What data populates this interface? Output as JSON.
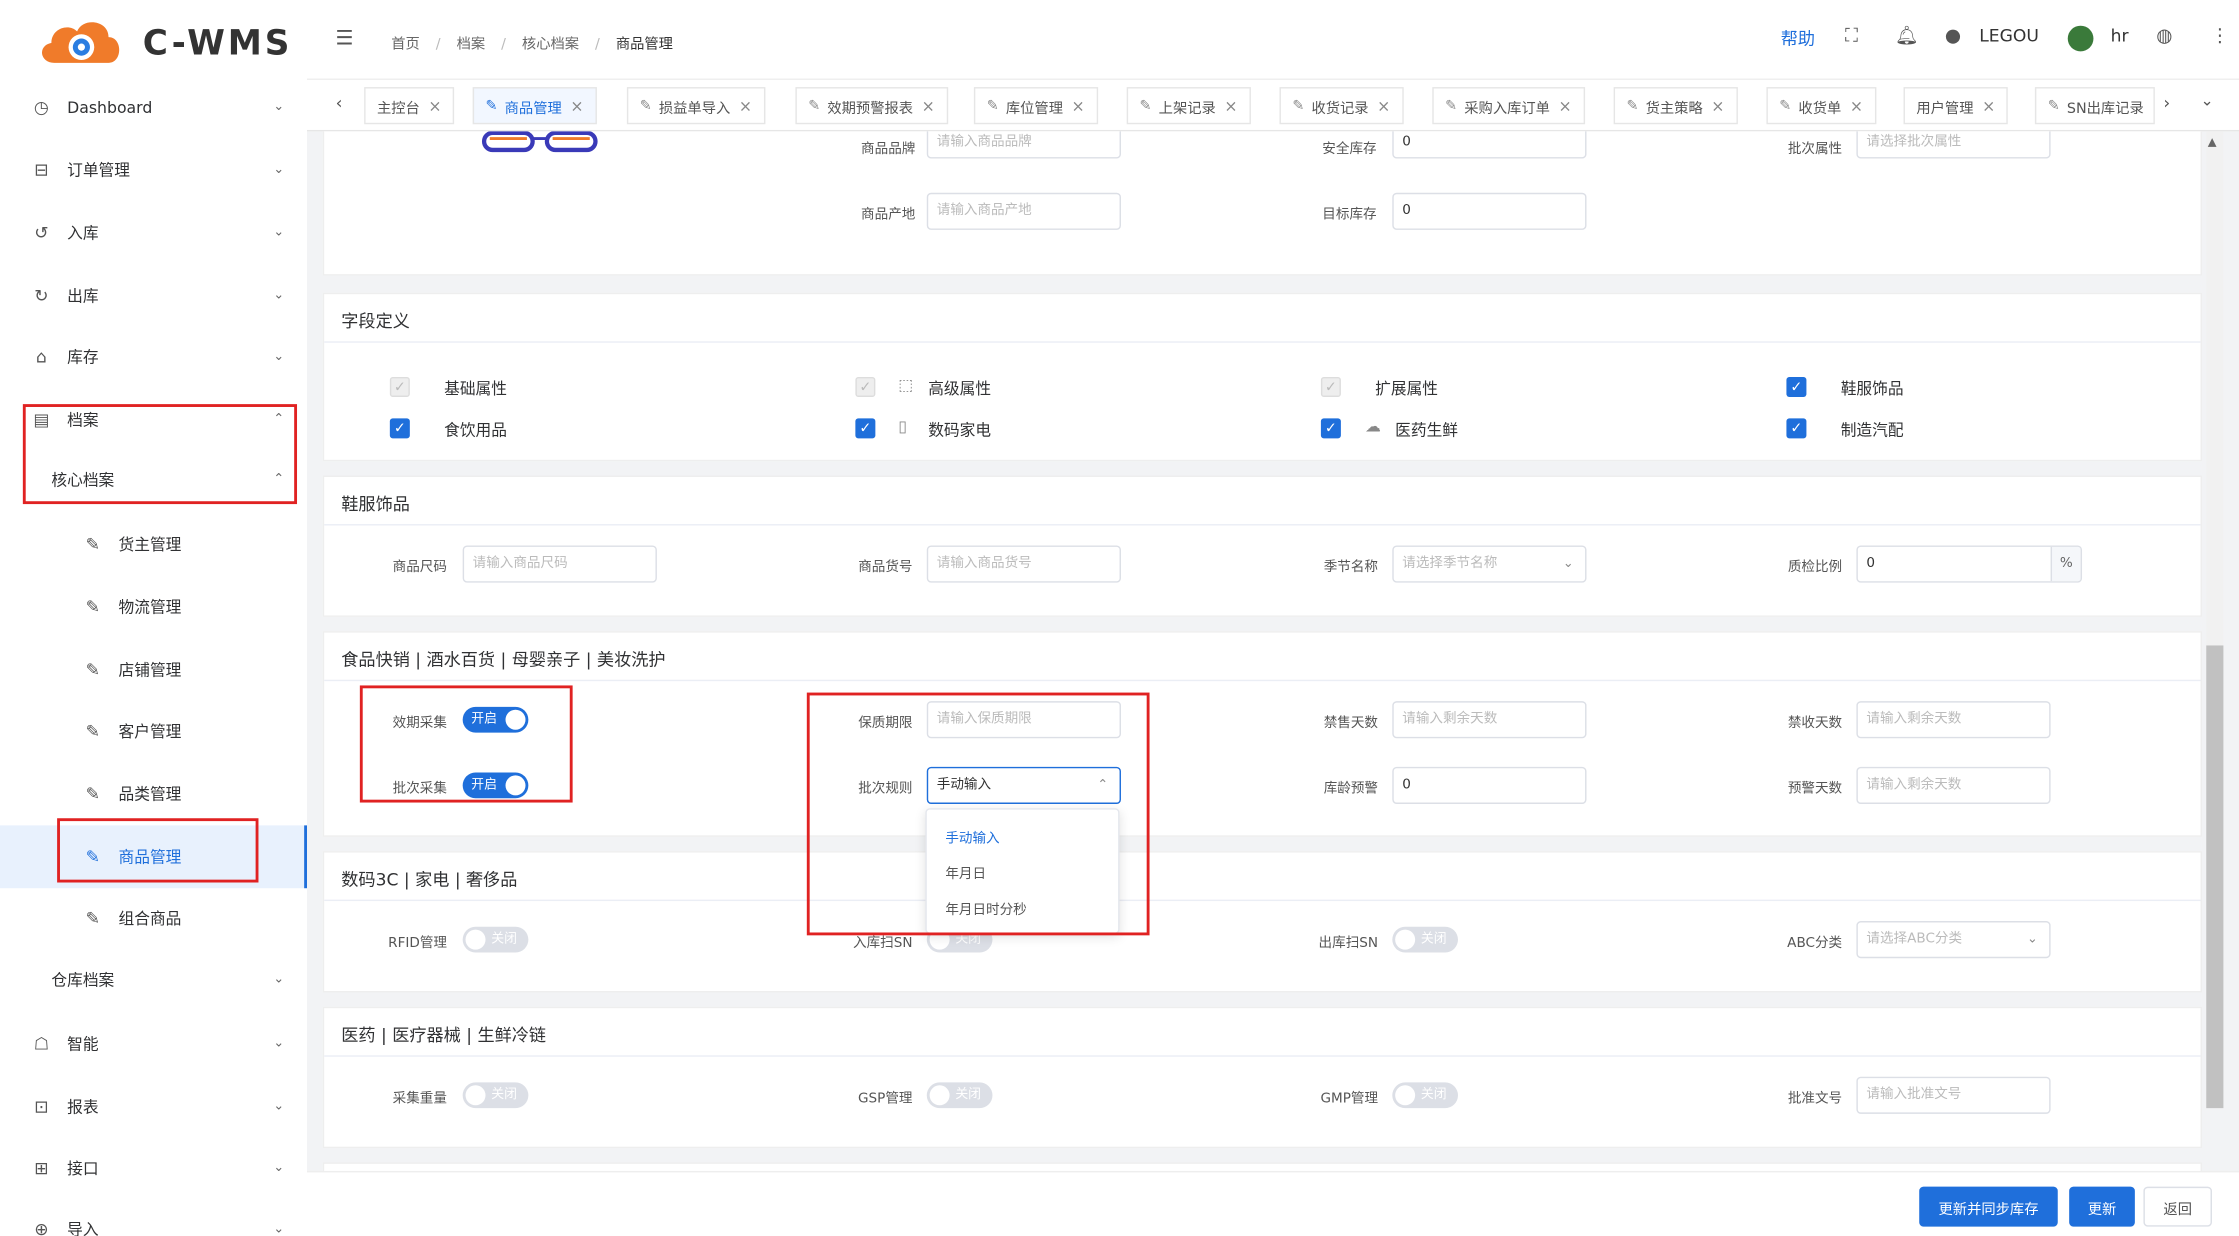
{
  "app": {
    "logo_text": "C-WMS"
  },
  "sidebar": {
    "items": [
      {
        "label": "Dashboard"
      },
      {
        "label": "订单管理"
      },
      {
        "label": "入库"
      },
      {
        "label": "出库"
      },
      {
        "label": "库存"
      },
      {
        "label": "档案"
      },
      {
        "label": "核心档案"
      },
      {
        "label": "货主管理"
      },
      {
        "label": "物流管理"
      },
      {
        "label": "店铺管理"
      },
      {
        "label": "客户管理"
      },
      {
        "label": "品类管理"
      },
      {
        "label": "商品管理"
      },
      {
        "label": "组合商品"
      },
      {
        "label": "仓库档案"
      },
      {
        "label": "智能"
      },
      {
        "label": "报表"
      },
      {
        "label": "接口"
      },
      {
        "label": "导入"
      }
    ]
  },
  "header": {
    "breadcrumb": [
      "首页",
      "档案",
      "核心档案",
      "商品管理"
    ],
    "help": "帮助",
    "company": "LEGOU",
    "user": "hr"
  },
  "tabs": [
    "主控台",
    "商品管理",
    "损益单导入",
    "效期预警报表",
    "库位管理",
    "上架记录",
    "收货记录",
    "采购入库订单",
    "货主策略",
    "收货单",
    "用户管理",
    "SN出库记录"
  ],
  "basic": {
    "brand_label": "商品品牌",
    "brand_ph": "请输入商品品牌",
    "safety_label": "安全库存",
    "safety_val": "0",
    "batch_attr_label": "批次属性",
    "batch_attr_ph": "请选择批次属性",
    "origin_label": "商品产地",
    "origin_ph": "请输入商品产地",
    "target_label": "目标库存",
    "target_val": "0"
  },
  "fields": {
    "title": "字段定义",
    "options": [
      {
        "label": "基础属性"
      },
      {
        "label": "高级属性"
      },
      {
        "label": "扩展属性"
      },
      {
        "label": "鞋服饰品"
      },
      {
        "label": "食饮用品"
      },
      {
        "label": "数码家电"
      },
      {
        "label": "医药生鲜"
      },
      {
        "label": "制造汽配"
      }
    ]
  },
  "apparel": {
    "title": "鞋服饰品",
    "size_label": "商品尺码",
    "size_ph": "请输入商品尺码",
    "sku_label": "商品货号",
    "sku_ph": "请输入商品货号",
    "season_label": "季节名称",
    "season_ph": "请选择季节名称",
    "qc_label": "质检比例",
    "qc_val": "0",
    "qc_unit": "%"
  },
  "food": {
    "title": "食品快销 | 酒水百货 | 母婴亲子 | 美妆洗护",
    "expiry_label": "效期采集",
    "expiry_state": "开启",
    "batch_label": "批次采集",
    "batch_state": "开启",
    "shelf_label": "保质期限",
    "shelf_ph": "请输入保质期限",
    "rule_label": "批次规则",
    "rule_val": "手动输入",
    "nosell_label": "禁售天数",
    "nosell_ph": "请输入剩余天数",
    "norecv_label": "禁收天数",
    "norecv_ph": "请输入剩余天数",
    "age_label": "库龄预警",
    "age_val": "0",
    "warn_label": "预警天数",
    "warn_ph": "请输入剩余天数",
    "rule_options": [
      "手动输入",
      "年月日",
      "年月日时分秒"
    ]
  },
  "digital": {
    "title": "数码3C | 家电 | 奢侈品",
    "rfid_label": "RFID管理",
    "rfid_state": "关闭",
    "insn_label": "入库扫SN",
    "insn_state": "关闭",
    "outsn_label": "出库扫SN",
    "outsn_state": "关闭",
    "abc_label": "ABC分类",
    "abc_ph": "请选择ABC分类"
  },
  "medical": {
    "title": "医药 | 医疗器械 | 生鲜冷链",
    "weight_label": "采集重量",
    "weight_state": "关闭",
    "gsp_label": "GSP管理",
    "gsp_state": "关闭",
    "gmp_label": "GMP管理",
    "gmp_state": "关闭",
    "approval_label": "批准文号",
    "approval_ph": "请输入批准文号"
  },
  "footer": {
    "sync_update": "更新并同步库存",
    "update": "更新",
    "back": "返回"
  },
  "colors": {
    "primary": "#1f6fdb",
    "highlight_box": "#e02222"
  }
}
